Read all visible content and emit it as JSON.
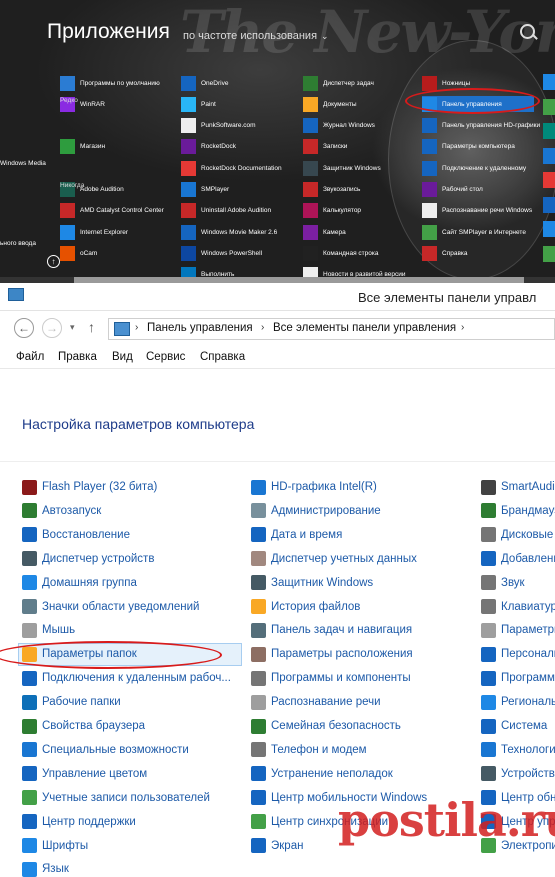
{
  "apps_screen": {
    "title": "Приложения",
    "sort_label": "по частоте использования",
    "columns": [
      {
        "group_labels": [
          "Редко",
          "Никогда"
        ],
        "items": [
          {
            "label": "Программы по умолчанию",
            "color": "#2b7cd3"
          },
          {
            "label": "WinRAR",
            "color": "#8a2be2"
          },
          {
            "label": "Магазин",
            "color": "#2e9c3e"
          },
          {
            "label": "Adobe Audition",
            "color": "#1a5e4e"
          },
          {
            "label": "AMD Catalyst Control Center",
            "color": "#c62828"
          },
          {
            "label": "Internet Explorer",
            "color": "#1e88e5"
          },
          {
            "label": "oCam",
            "color": "#e65100"
          }
        ],
        "left_items": [
          "Windows Media",
          "ьного ввода"
        ]
      },
      {
        "items": [
          {
            "label": "OneDrive",
            "color": "#1565c0"
          },
          {
            "label": "Paint",
            "color": "#29b6f6"
          },
          {
            "label": "PunkSoftware.com",
            "color": "#eeeeee"
          },
          {
            "label": "RocketDock",
            "color": "#6a1b9a"
          },
          {
            "label": "RocketDock Documentation",
            "color": "#e53935"
          },
          {
            "label": "SMPlayer",
            "color": "#1976d2"
          },
          {
            "label": "Uninstall Adobe Audition",
            "color": "#c62828"
          },
          {
            "label": "Windows Movie Maker 2.6",
            "color": "#1565c0"
          },
          {
            "label": "Windows PowerShell",
            "color": "#0d47a1"
          },
          {
            "label": "Выполнить",
            "color": "#0277bd"
          }
        ]
      },
      {
        "items": [
          {
            "label": "Диспетчер задач",
            "color": "#2e7d32"
          },
          {
            "label": "Документы",
            "color": "#f9a825"
          },
          {
            "label": "Журнал Windows",
            "color": "#1565c0"
          },
          {
            "label": "Записки",
            "color": "#c62828"
          },
          {
            "label": "Защитник Windows",
            "color": "#37474f"
          },
          {
            "label": "Звукозапись",
            "color": "#c62828"
          },
          {
            "label": "Калькулятор",
            "color": "#ad1457"
          },
          {
            "label": "Камера",
            "color": "#7b1fa2"
          },
          {
            "label": "Командная строка",
            "color": "#212121"
          },
          {
            "label": "Новости в развитой версии",
            "color": "#eeeeee"
          }
        ]
      },
      {
        "items": [
          {
            "label": "Ножницы",
            "color": "#b71c1c"
          },
          {
            "label": "Панель управления",
            "color": "#1e88e5"
          },
          {
            "label": "Панель управления HD-графики",
            "color": "#1565c0"
          },
          {
            "label": "Параметры компьютера",
            "color": "#1565c0"
          },
          {
            "label": "Подключение к удаленному",
            "color": "#1565c0"
          },
          {
            "label": "Рабочий стол",
            "color": "#6a1b9a"
          },
          {
            "label": "Распознавание речи Windows",
            "color": "#eeeeee"
          },
          {
            "label": "Сайт SMPlayer в Интернете",
            "color": "#43a047"
          },
          {
            "label": "Справка",
            "color": "#c62828"
          }
        ]
      }
    ]
  },
  "control_panel": {
    "window_title": "Все элементы панели управл",
    "address": {
      "segments": [
        "Панель управления",
        "Все элементы панели управления"
      ]
    },
    "menu": [
      "Файл",
      "Правка",
      "Вид",
      "Сервис",
      "Справка"
    ],
    "heading": "Настройка параметров компьютера",
    "col1": [
      {
        "label": "Flash Player (32 бита)",
        "color": "#8b1a1a"
      },
      {
        "label": "Автозапуск",
        "color": "#2e7d32"
      },
      {
        "label": "Восстановление",
        "color": "#1565c0"
      },
      {
        "label": "Диспетчер устройств",
        "color": "#455a64"
      },
      {
        "label": "Домашняя группа",
        "color": "#1e88e5"
      },
      {
        "label": "Значки области уведомлений",
        "color": "#607d8b"
      },
      {
        "label": "Мышь",
        "color": "#9e9e9e"
      },
      {
        "label": "Параметры папок",
        "color": "#f9a825"
      },
      {
        "label": "Подключения к удаленным рабоч...",
        "color": "#1565c0"
      },
      {
        "label": "Рабочие папки",
        "color": "#0d6fb8"
      },
      {
        "label": "Свойства браузера",
        "color": "#2e7d32"
      },
      {
        "label": "Специальные возможности",
        "color": "#1976d2"
      },
      {
        "label": "Управление цветом",
        "color": "#1565c0"
      },
      {
        "label": "Учетные записи пользователей",
        "color": "#43a047"
      },
      {
        "label": "Центр поддержки",
        "color": "#1565c0"
      },
      {
        "label": "Шрифты",
        "color": "#1e88e5"
      },
      {
        "label": "Язык",
        "color": "#1e88e5"
      }
    ],
    "col2": [
      {
        "label": "HD-графика Intel(R)",
        "color": "#1976d2"
      },
      {
        "label": "Администрирование",
        "color": "#78909c"
      },
      {
        "label": "Дата и время",
        "color": "#1565c0"
      },
      {
        "label": "Диспетчер учетных данных",
        "color": "#a1887f"
      },
      {
        "label": "Защитник Windows",
        "color": "#455a64"
      },
      {
        "label": "История файлов",
        "color": "#f9a825"
      },
      {
        "label": "Панель задач и навигация",
        "color": "#546e7a"
      },
      {
        "label": "Параметры расположения",
        "color": "#8d6e63"
      },
      {
        "label": "Программы и компоненты",
        "color": "#757575"
      },
      {
        "label": "Распознавание речи",
        "color": "#9e9e9e"
      },
      {
        "label": "Семейная безопасность",
        "color": "#2e7d32"
      },
      {
        "label": "Телефон и модем",
        "color": "#757575"
      },
      {
        "label": "Устранение неполадок",
        "color": "#1565c0"
      },
      {
        "label": "Центр мобильности Windows",
        "color": "#1565c0"
      },
      {
        "label": "Центр синхронизации",
        "color": "#43a047"
      },
      {
        "label": "Экран",
        "color": "#1565c0"
      }
    ],
    "col3": [
      {
        "label": "SmartAudio",
        "color": "#424242"
      },
      {
        "label": "Брандмауэ",
        "color": "#2e7d32"
      },
      {
        "label": "Дисковые",
        "color": "#757575"
      },
      {
        "label": "Добавлени",
        "color": "#1565c0"
      },
      {
        "label": "Звук",
        "color": "#757575"
      },
      {
        "label": "Клавиатур",
        "color": "#757575"
      },
      {
        "label": "Параметры",
        "color": "#9e9e9e"
      },
      {
        "label": "Персонали",
        "color": "#1565c0"
      },
      {
        "label": "Программ",
        "color": "#1565c0"
      },
      {
        "label": "Региональ",
        "color": "#1e88e5"
      },
      {
        "label": "Система",
        "color": "#1565c0"
      },
      {
        "label": "Технологи",
        "color": "#1976d2"
      },
      {
        "label": "Устройства",
        "color": "#455a64"
      },
      {
        "label": "Центр обн",
        "color": "#1565c0"
      },
      {
        "label": "Центр упр",
        "color": "#1565c0"
      },
      {
        "label": "Электропи",
        "color": "#43a047"
      }
    ]
  },
  "watermark": "postila.ru"
}
